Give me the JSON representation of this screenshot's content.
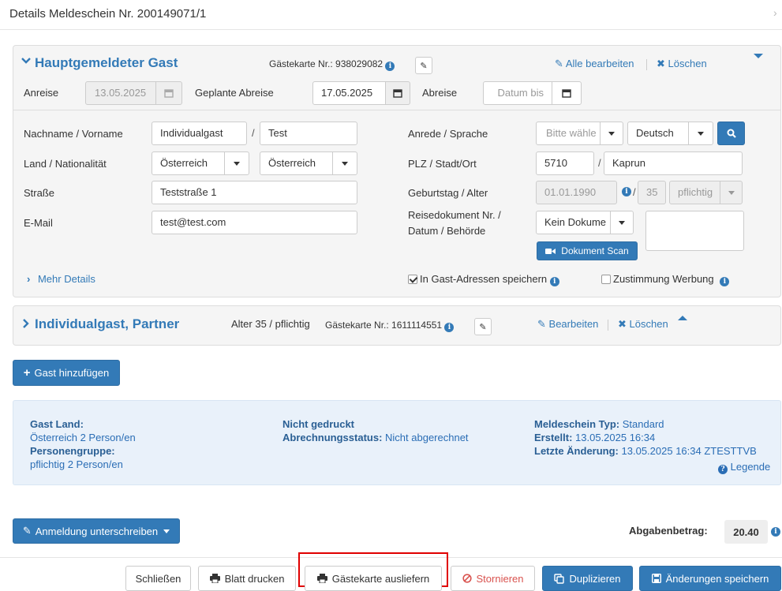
{
  "header": {
    "title": "Details Meldeschein Nr. 200149071/1",
    "nav_icon": "chevron-right-icon"
  },
  "main_guest": {
    "heading": "Hauptgemeldeter Gast",
    "guest_card_label": "Gästekarte Nr.: 938029082",
    "edit_all": "Alle bearbeiten",
    "delete": "Löschen",
    "arrival_label": "Anreise",
    "arrival_value": "13.05.2025",
    "planned_departure_label": "Geplante Abreise",
    "planned_departure_value": "17.05.2025",
    "departure_label": "Abreise",
    "departure_placeholder": "Datum bis",
    "name_label": "Nachname / Vorname",
    "last_name": "Individualgast",
    "first_name": "Test",
    "slash": "/",
    "country_label": "Land / Nationalität",
    "country": "Österreich",
    "nationality": "Österreich",
    "street_label": "Straße",
    "street": "Teststraße 1",
    "email_label": "E-Mail",
    "email": "test@test.com",
    "salutation_label": "Anrede / Sprache",
    "salutation_placeholder": "Bitte wähle",
    "language": "Deutsch",
    "zip_label": "PLZ / Stadt/Ort",
    "zip": "5710",
    "city": "Kaprun",
    "birthday_label": "Geburtstag / Alter",
    "birthday": "01.01.1990",
    "age": "35",
    "age_category": "pflichtig",
    "doc_label_1": "Reisedokument Nr. /",
    "doc_label_2": "Datum / Behörde",
    "doc_type": "Kein Dokume",
    "doc_scan": "Dokument Scan",
    "more_details": "Mehr Details",
    "save_address_label": "In Gast-Adressen speichern",
    "save_address_checked": true,
    "advertising_label": "Zustimmung Werbung",
    "advertising_checked": false
  },
  "partner": {
    "heading": "Individualgast, Partner",
    "age_info": "Alter 35 / pflichtig",
    "guest_card_label": "Gästekarte Nr.: 1611114551",
    "edit": "Bearbeiten",
    "delete": "Löschen"
  },
  "add_guest_button": "Gast hinzufügen",
  "summary": {
    "guest_country_label": "Gast Land:",
    "guest_country_value": "Österreich 2 Person/en",
    "group_label": "Personengruppe:",
    "group_value": "pflichtig 2 Person/en",
    "print_status": "Nicht gedruckt",
    "billing_label": "Abrechnungsstatus:",
    "billing_value": "Nicht abgerechnet",
    "type_label": "Meldeschein Typ:",
    "type_value": "Standard",
    "created_label": "Erstellt:",
    "created_value": "13.05.2025 16:34",
    "changed_label": "Letzte Änderung:",
    "changed_value": "13.05.2025 16:34 ZTESTTVB",
    "legend": "Legende"
  },
  "sign_button": "Anmeldung unterschreiben",
  "fee": {
    "label": "Abgabenbetrag:",
    "value": "20.40"
  },
  "footer": {
    "close": "Schließen",
    "print_sheet": "Blatt drucken",
    "deliver_card": "Gästekarte ausliefern",
    "cancel": "Stornieren",
    "duplicate": "Duplizieren",
    "save": "Änderungen speichern"
  },
  "colors": {
    "primary": "#337ab7",
    "panel": "#f5f5f5",
    "info_panel": "#e9f1fa",
    "danger": "#d9534f",
    "highlight": "#e00000"
  }
}
